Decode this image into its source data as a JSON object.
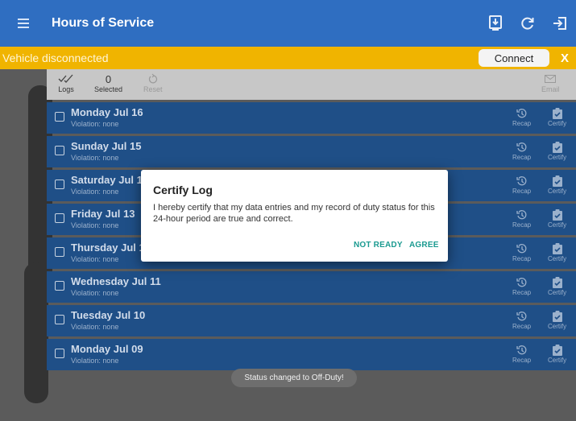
{
  "app": {
    "title": "Hours of Service"
  },
  "banner": {
    "text": "Vehicle disconnected",
    "connect_label": "Connect",
    "close_label": "X"
  },
  "toolbar": {
    "logs_label": "Logs",
    "selected_count": "0",
    "selected_label": "Selected",
    "reset_label": "Reset",
    "email_label": "Email"
  },
  "logs": [
    {
      "day": "Monday Jul 16",
      "violation": "Violation: none"
    },
    {
      "day": "Sunday Jul 15",
      "violation": "Violation: none"
    },
    {
      "day": "Saturday Jul 14",
      "violation": "Violation: none"
    },
    {
      "day": "Friday Jul 13",
      "violation": "Violation: none"
    },
    {
      "day": "Thursday Jul 12",
      "violation": "Violation: none"
    },
    {
      "day": "Wednesday Jul 11",
      "violation": "Violation: none"
    },
    {
      "day": "Tuesday Jul 10",
      "violation": "Violation: none"
    },
    {
      "day": "Monday Jul 09",
      "violation": "Violation: none"
    }
  ],
  "row_actions": {
    "recap_label": "Recap",
    "certify_label": "Certify"
  },
  "dialog": {
    "title": "Certify Log",
    "body": "I hereby certify that my data entries and my record of duty status for this 24-hour period are true and correct.",
    "not_ready_label": "NOT READY",
    "agree_label": "AGREE"
  },
  "toast": {
    "text": "Status changed to Off-Duty!"
  },
  "icons": {
    "menu": "hamburger-icon",
    "device": "device-download-icon",
    "refresh": "refresh-icon",
    "logout": "logout-icon",
    "logs": "checkmarks-icon",
    "reset": "reset-icon",
    "email": "email-icon",
    "recap": "history-icon",
    "certify": "clipboard-check-icon"
  },
  "colors": {
    "appbar": "#2f6ec1",
    "banner": "#f0b400",
    "row": "#1f4f87",
    "accent": "#1a9a90"
  }
}
